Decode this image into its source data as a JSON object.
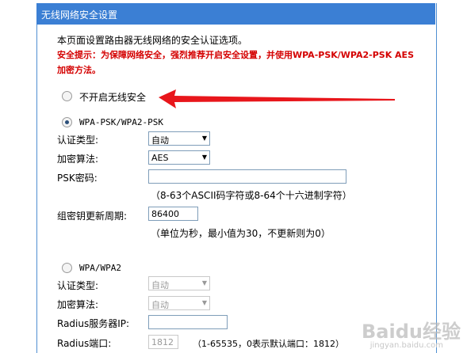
{
  "header": {
    "title": "无线网络安全设置"
  },
  "intro": {
    "line1": "本页面设置路由器无线网络的安全认证选项。",
    "warning1": "安全提示：为保障网络安全，强烈推荐开启安全设置，并使用WPA-PSK/WPA2-PSK AES",
    "warning2": "加密方法。"
  },
  "options": {
    "none_label": "不开启无线安全",
    "psk_label": "WPA-PSK/WPA2-PSK",
    "wpa_label": "WPA/WPA2"
  },
  "psk": {
    "auth_label": "认证类型:",
    "auth_value": "自动",
    "algo_label": "加密算法:",
    "algo_value": "AES",
    "pwd_label": "PSK密码:",
    "pwd_value": "",
    "pwd_hint": "（8-63个ASCII码字符或8-64个十六进制字符）",
    "period_label": "组密钥更新周期:",
    "period_value": "86400",
    "period_hint": "（单位为秒，最小值为30，不更新则为0）"
  },
  "wpa": {
    "auth_label": "认证类型:",
    "auth_value": "自动",
    "algo_label": "加密算法:",
    "algo_value": "自动",
    "ip_label": "Radius服务器IP:",
    "ip_value": "",
    "port_label": "Radius端口:",
    "port_value": "1812",
    "port_hint": "（1-65535，0表示默认端口：1812）"
  },
  "watermark": {
    "brand": "Baidu经验",
    "sub": "jingyan.baidu.com"
  },
  "colors": {
    "header": "#3b7fd4",
    "warning": "#d40000",
    "arrow": "#e8161b"
  }
}
